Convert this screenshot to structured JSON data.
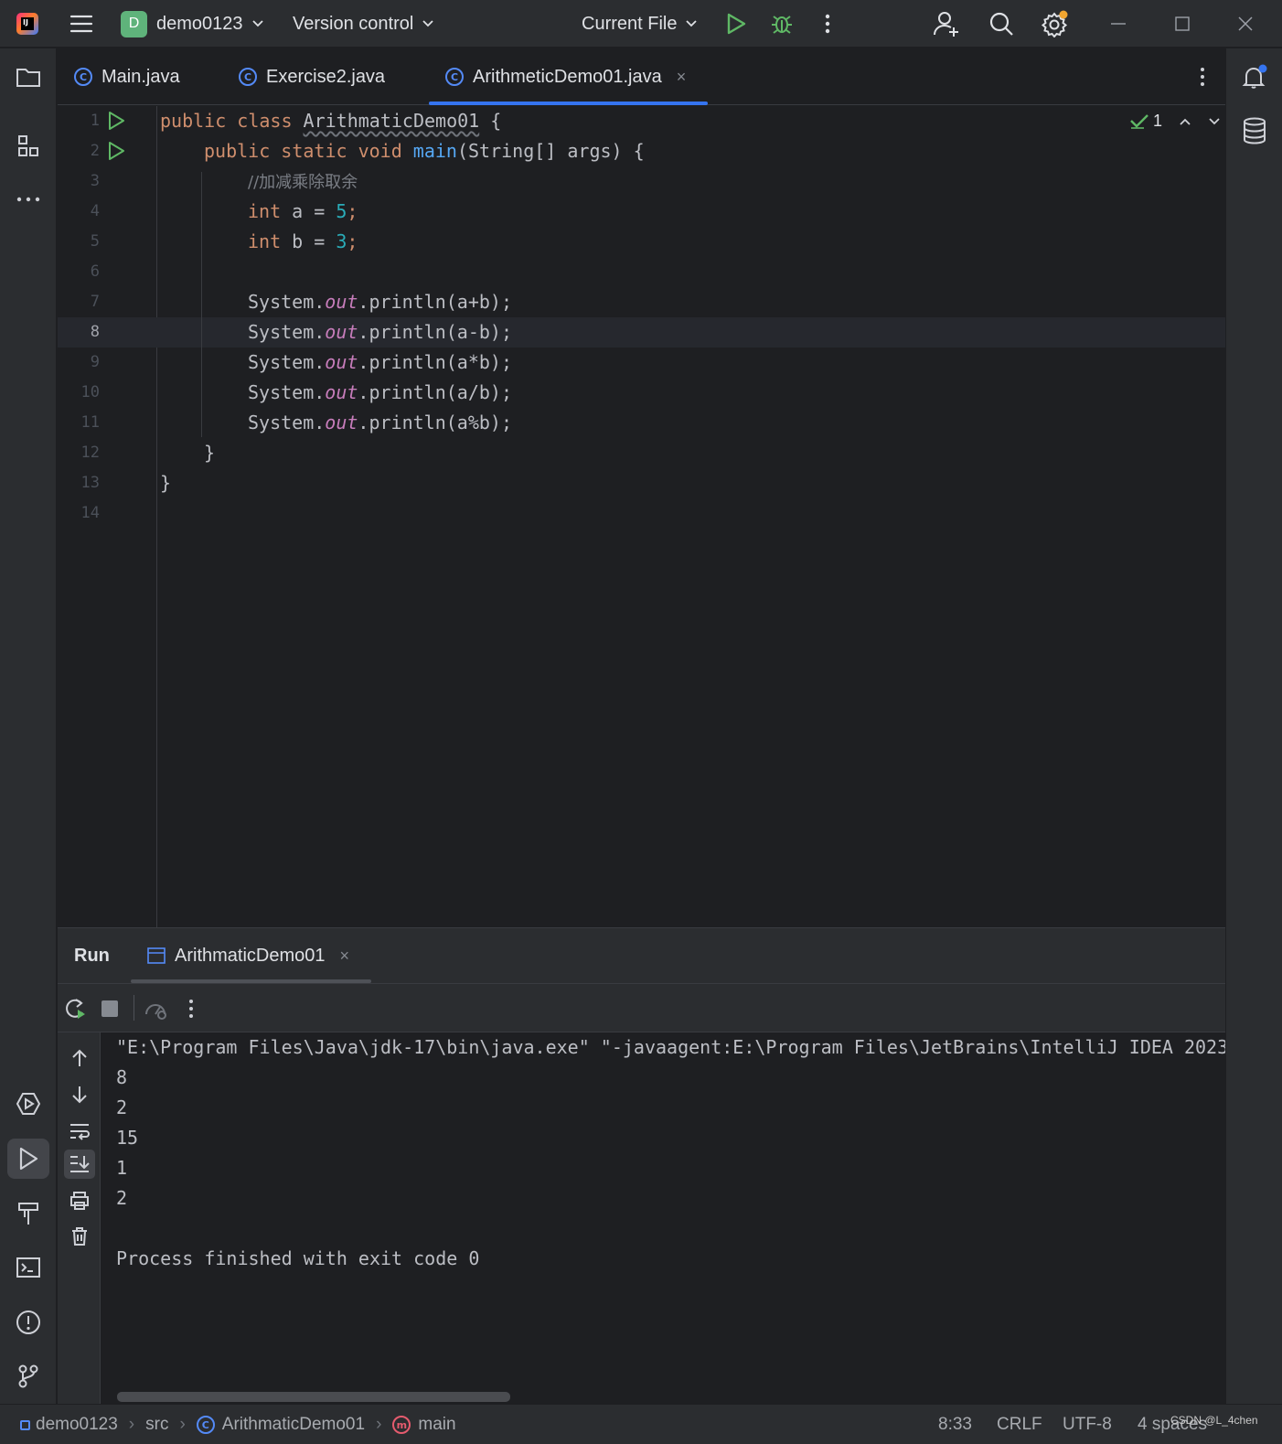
{
  "titlebar": {
    "logo_text": "IJ",
    "project_badge": "D",
    "project_name": "demo0123",
    "vcs_label": "Version control",
    "run_config": "Current File"
  },
  "tabs": [
    {
      "label": "Main.java",
      "icon": "class-icon",
      "active": false
    },
    {
      "label": "Exercise2.java",
      "icon": "class-icon",
      "active": false
    },
    {
      "label": "ArithmeticDemo01.java",
      "icon": "class-icon",
      "active": true
    }
  ],
  "tab_close_glyph": "×",
  "class_icon_glyph": "C",
  "inspection": {
    "count": "1"
  },
  "editor": {
    "current_line": 8,
    "lines": [
      {
        "n": "1"
      },
      {
        "n": "2"
      },
      {
        "n": "3"
      },
      {
        "n": "4"
      },
      {
        "n": "5"
      },
      {
        "n": "6"
      },
      {
        "n": "7"
      },
      {
        "n": "8"
      },
      {
        "n": "9"
      },
      {
        "n": "10"
      },
      {
        "n": "11"
      },
      {
        "n": "12"
      },
      {
        "n": "13"
      },
      {
        "n": "14"
      }
    ],
    "tokens": {
      "l1_kw": "public class ",
      "l1_name": "ArithmaticDemo01",
      "l1_rest": " {",
      "l2_kw": "public static void ",
      "l2_fn": "main",
      "l2_rest": "(String[] args) {",
      "l3_comment": "//加减乘除取余",
      "l4_kw": "int",
      "l4_mid": " a = ",
      "l4_num": "5",
      "l4_end": ";",
      "l5_kw": "int",
      "l5_mid": " b = ",
      "l5_num": "3",
      "l5_end": ";",
      "sys": "System.",
      "out": "out",
      "l7_rest": ".println(a+b);",
      "l8_rest": ".println(a-b);",
      "l9_rest": ".println(a*b);",
      "l10_rest": ".println(a/b);",
      "l11_rest": ".println(a%b);",
      "l12": "}",
      "l13": "}"
    }
  },
  "run_window": {
    "title": "Run",
    "tab_label": "ArithmaticDemo01",
    "console_lines": [
      "\"E:\\Program Files\\Java\\jdk-17\\bin\\java.exe\" \"-javaagent:E:\\Program Files\\JetBrains\\IntelliJ IDEA 2023.",
      "8",
      "2",
      "15",
      "1",
      "2",
      "",
      "Process finished with exit code 0"
    ]
  },
  "statusbar": {
    "crumbs": [
      "demo0123",
      "src",
      "ArithmaticDemo01",
      "main"
    ],
    "crumb_sep": "›",
    "method_icon_glyph": "m",
    "position": "8:33",
    "line_sep": "CRLF",
    "encoding": "UTF-8",
    "indent": "4 spaces"
  },
  "watermark": "CSDN @L_4chen",
  "colors": {
    "accent": "#3574f0",
    "run_green": "#5fb865",
    "keyword": "#cf8e6d",
    "number": "#2aacb8",
    "function": "#56a8f5",
    "static_field": "#c77dbb"
  }
}
